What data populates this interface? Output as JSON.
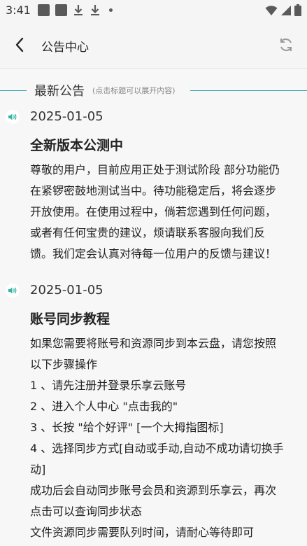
{
  "status_bar": {
    "time": "3:41",
    "icons": [
      "notification-square-icon",
      "notification-square-icon",
      "download-icon",
      "download-icon",
      "dot-icon",
      "wifi-icon",
      "signal-icon",
      "battery-icon"
    ]
  },
  "app_bar": {
    "back_icon": "back-arrow-icon",
    "title": "公告中心",
    "refresh_icon": "refresh-icon"
  },
  "section": {
    "title": "最新公告",
    "hint": "(点击标题可以展开内容)",
    "accent_color": "#2aa3a3"
  },
  "notices": [
    {
      "icon": "speaker-icon",
      "date": "2025-01-05",
      "title": "全新版本公测中",
      "body_lines": [
        "尊敬的用户，目前应用正处于测试阶段 部分功能仍",
        "在紧锣密鼓地测试当中。待功能稳定后，将会逐步",
        "开放使用。在使用过程中，倘若您遇到任何问题，",
        "或者有任何宝贵的建议，烦请联系客服向我们反",
        "馈。我们定会认真对待每一位用户的反馈与建议！"
      ]
    },
    {
      "icon": "speaker-icon",
      "date": "2025-01-05",
      "title": "账号同步教程",
      "body_lines": [
        "如果您需要将账号和资源同步到本云盘，请您按照",
        "以下步骤操作",
        "1 、请先注册并登录乐享云账号",
        "2 、进入个人中心 \"点击我的\"",
        "3 、长按 \"给个好评\" [一个大拇指图标]",
        "4 、选择同步方式[自动或手动,自动不成功请切换手",
        "动]",
        "成功后会自动同步账号会员和资源到乐享云，再次",
        "点击可以查询同步状态",
        "文件资源同步需要队列时间，请耐心等待即可"
      ]
    }
  ]
}
